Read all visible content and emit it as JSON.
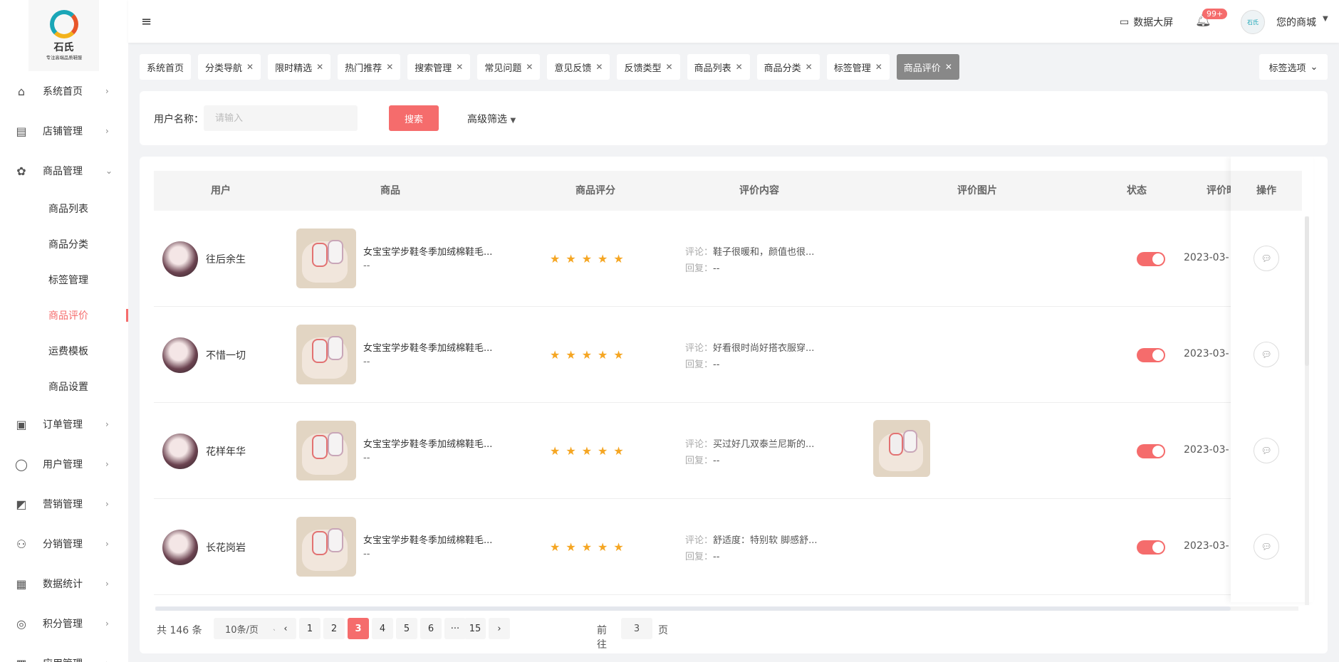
{
  "brand": {
    "name": "石氏",
    "tagline": "专注高端品质鞋服"
  },
  "sidebar": {
    "items": [
      {
        "label": "系统首页",
        "icon": "home-icon"
      },
      {
        "label": "店铺管理",
        "icon": "store-icon"
      },
      {
        "label": "商品管理",
        "icon": "goods-icon",
        "expanded": true,
        "children": [
          "商品列表",
          "商品分类",
          "标签管理",
          "商品评价",
          "运费模板",
          "商品设置"
        ],
        "active_child": "商品评价"
      },
      {
        "label": "订单管理",
        "icon": "order-icon"
      },
      {
        "label": "用户管理",
        "icon": "user-icon"
      },
      {
        "label": "营销管理",
        "icon": "marketing-icon"
      },
      {
        "label": "分销管理",
        "icon": "distribution-icon"
      },
      {
        "label": "数据统计",
        "icon": "chart-icon"
      },
      {
        "label": "积分管理",
        "icon": "points-icon"
      },
      {
        "label": "应用管理",
        "icon": "app-icon"
      }
    ]
  },
  "header": {
    "menu_icon": "≡",
    "screen_label": "数据大屏",
    "notification_badge": "99+",
    "avatar_text": "石氏",
    "shop_label": "您的商城"
  },
  "tags": {
    "items": [
      "系统首页",
      "分类导航",
      "限时精选",
      "热门推荐",
      "搜索管理",
      "常见问题",
      "意见反馈",
      "反馈类型",
      "商品列表",
      "商品分类",
      "标签管理",
      "商品评价"
    ],
    "closable": [
      false,
      true,
      true,
      true,
      true,
      true,
      true,
      true,
      true,
      true,
      true,
      true
    ],
    "active": "商品评价",
    "options_label": "标签选项"
  },
  "search": {
    "label": "用户名称：",
    "placeholder": "请输入",
    "button": "搜索",
    "advanced": "高级筛选"
  },
  "table": {
    "columns": [
      "用户",
      "商品",
      "商品评分",
      "评价内容",
      "评价图片",
      "状态",
      "评价时间",
      "操作"
    ],
    "comment_label": "评论：",
    "reply_label": "回复：",
    "rows": [
      {
        "user": "往后余生",
        "product": "女宝宝学步鞋冬季加绒棉鞋毛...",
        "product_sub": "--",
        "rating": 5,
        "comment": "鞋子很暖和，颜值也很...",
        "reply": "--",
        "has_image": false,
        "status_on": true,
        "time": "2023-03-"
      },
      {
        "user": "不惜一切",
        "product": "女宝宝学步鞋冬季加绒棉鞋毛...",
        "product_sub": "--",
        "rating": 5,
        "comment": "好看很时尚好搭衣服穿...",
        "reply": "--",
        "has_image": false,
        "status_on": true,
        "time": "2023-03-"
      },
      {
        "user": "花样年华",
        "product": "女宝宝学步鞋冬季加绒棉鞋毛...",
        "product_sub": "--",
        "rating": 5,
        "comment": "买过好几双泰兰尼斯的...",
        "reply": "--",
        "has_image": true,
        "status_on": true,
        "time": "2023-03-"
      },
      {
        "user": "长花岗岩",
        "product": "女宝宝学步鞋冬季加绒棉鞋毛...",
        "product_sub": "--",
        "rating": 5,
        "comment": "舒适度：特别软 脚感舒...",
        "reply": "--",
        "has_image": false,
        "status_on": true,
        "time": "2023-03-"
      }
    ]
  },
  "pagination": {
    "total_text": "共 146 条",
    "page_size": "10条/页",
    "pages": [
      "1",
      "2",
      "3",
      "4",
      "5",
      "6",
      "···",
      "15"
    ],
    "current": "3",
    "goto_label": "前往",
    "goto_value": "3",
    "page_suffix": "页"
  },
  "colors": {
    "accent": "#f56c6c",
    "star": "#f5a623",
    "tag_active": "#888888"
  }
}
